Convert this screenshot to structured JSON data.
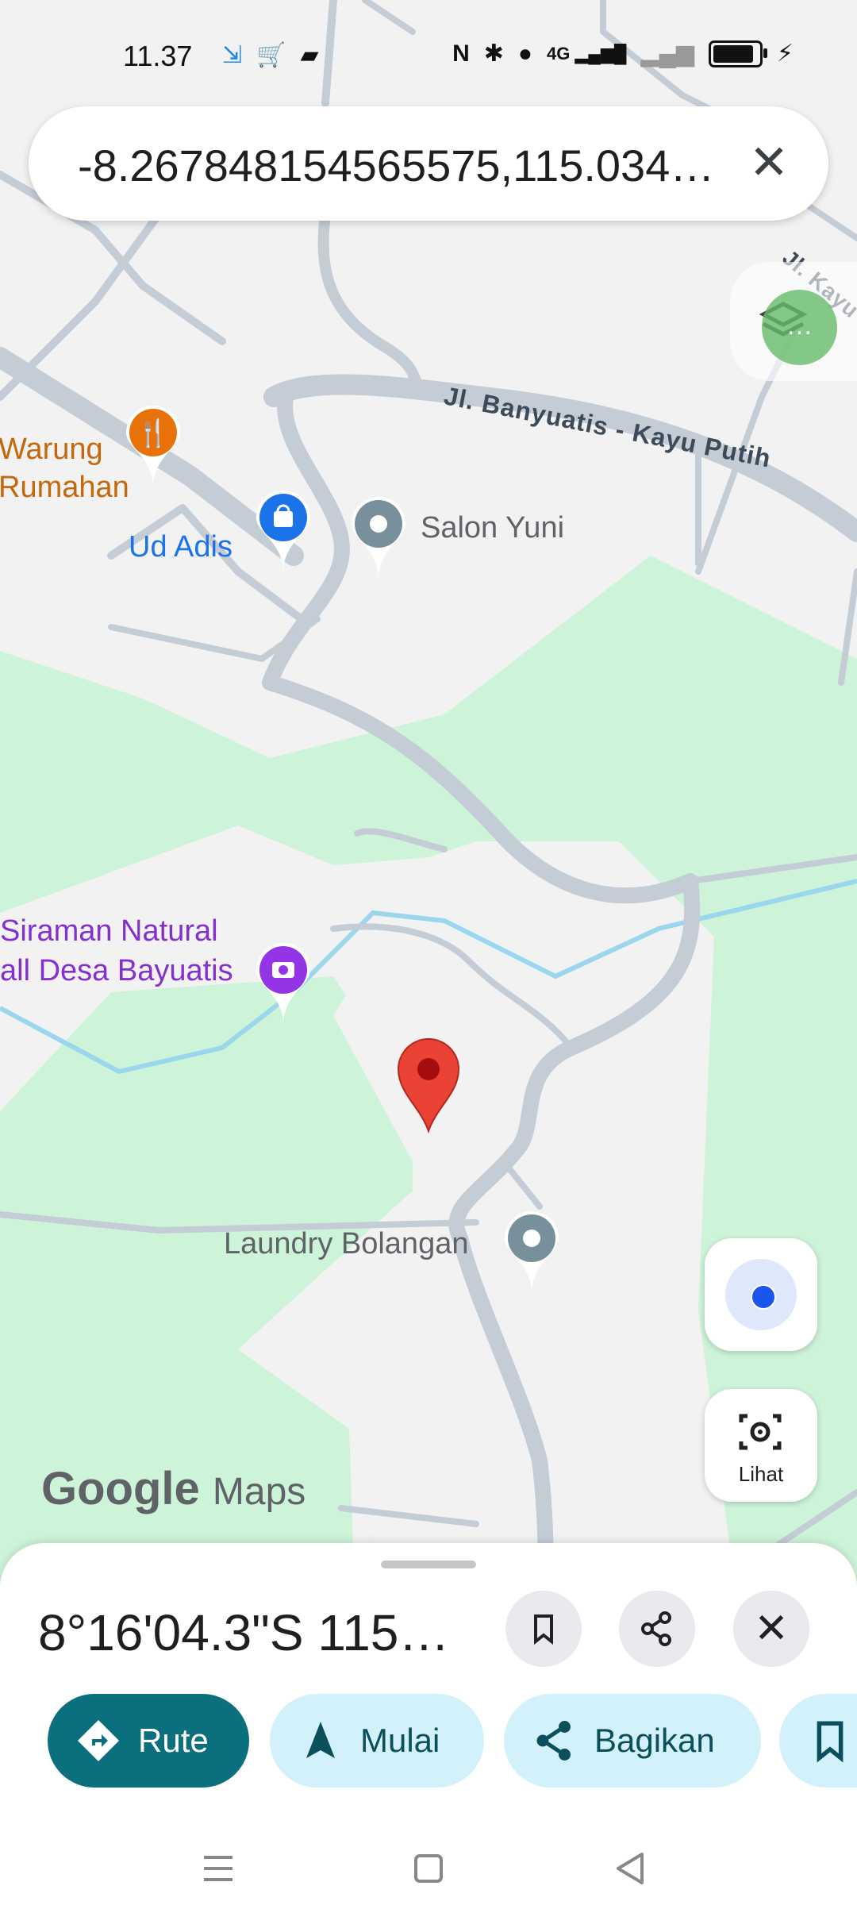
{
  "status_bar": {
    "time": "11.37",
    "left_icons": [
      "app-notification-icon",
      "shopping-app-icon",
      "message-app-icon"
    ],
    "right_icons": [
      "nfc-icon",
      "bluetooth-icon",
      "location-icon",
      "signal-4g-icon",
      "signal-muted-icon",
      "battery-icon",
      "charging-icon"
    ],
    "network_label": "4G",
    "battery_level": 0.9
  },
  "search": {
    "query": "-8.267848154565575,115.034…",
    "clear_icon": "close-icon"
  },
  "map": {
    "road_labels": [
      {
        "text": "Jl. Banyuatis - Kayu Putih"
      },
      {
        "text": "Jl. Kayu"
      }
    ],
    "places": [
      {
        "name": "Warung\nRumahan",
        "category": "restaurant",
        "icon": "fork-knife-icon",
        "color": "#e8710a"
      },
      {
        "name": "Ud Adis",
        "category": "shopping",
        "icon": "shopping-bag-icon",
        "color": "#1a73e8"
      },
      {
        "name": "Salon Yuni",
        "category": "generic",
        "icon": "pin-icon",
        "color": "#78909c"
      },
      {
        "name": "Siraman Natural\nall Desa Bayuatis",
        "category": "attraction",
        "icon": "camera-icon",
        "color": "#9334e6"
      },
      {
        "name": "Laundry Bolangan",
        "category": "generic",
        "icon": "pin-icon",
        "color": "#78909c"
      }
    ],
    "selected_marker_color": "#ea4335",
    "water_color": "#9bd7ec",
    "park_color": "#cdf3d9",
    "road_color": "#c4ccd6",
    "logo_text_1": "Google",
    "logo_text_2": "Maps"
  },
  "controls": {
    "my_location_icon": "my-location-icon",
    "lens_label": "Lihat",
    "lens_icon": "camera-lens-icon",
    "layers_icon": "layers-icon"
  },
  "sheet": {
    "title": "8°16'04.3\"S 115°…",
    "save_icon": "bookmark-icon",
    "share_icon": "share-icon",
    "close_icon": "close-icon",
    "chips": [
      {
        "label": "Rute",
        "icon": "directions-icon",
        "style": "primary"
      },
      {
        "label": "Mulai",
        "icon": "navigation-arrow-icon",
        "style": "secondary"
      },
      {
        "label": "Bagikan",
        "icon": "share-icon",
        "style": "secondary"
      },
      {
        "label": "",
        "icon": "bookmark-icon",
        "style": "secondary"
      }
    ]
  },
  "nav_bar": {
    "items": [
      "menu-icon",
      "home-icon",
      "back-icon"
    ]
  }
}
